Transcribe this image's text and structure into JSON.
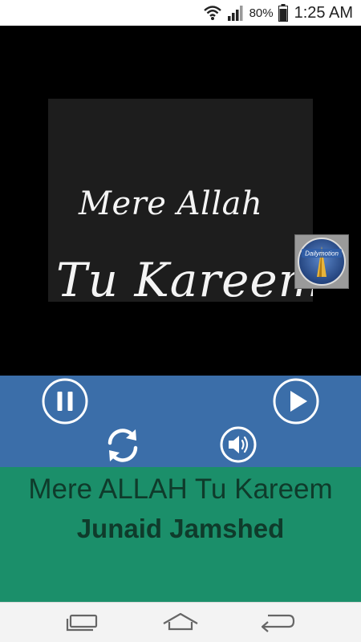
{
  "status_bar": {
    "battery_percent": "80%",
    "time": "1:25 AM",
    "icons": [
      "wifi-icon",
      "signal-icon",
      "battery-icon"
    ]
  },
  "video": {
    "thumbnail_text_line1": "Mere Allah",
    "thumbnail_text_line2": "Tu Kareem",
    "badge_label": "Dailymotion"
  },
  "controls": {
    "icons": [
      "pause-icon",
      "play-icon",
      "repeat-icon",
      "volume-icon"
    ]
  },
  "track": {
    "title": "Mere ALLAH Tu Kareem",
    "artist": "Junaid Jamshed"
  },
  "nav": {
    "icons": [
      "recent-apps-icon",
      "home-icon",
      "back-icon"
    ]
  },
  "colors": {
    "controls_bg": "#3b6ea9",
    "info_bg": "#1b8f6a",
    "info_text": "#0f3b2b"
  }
}
